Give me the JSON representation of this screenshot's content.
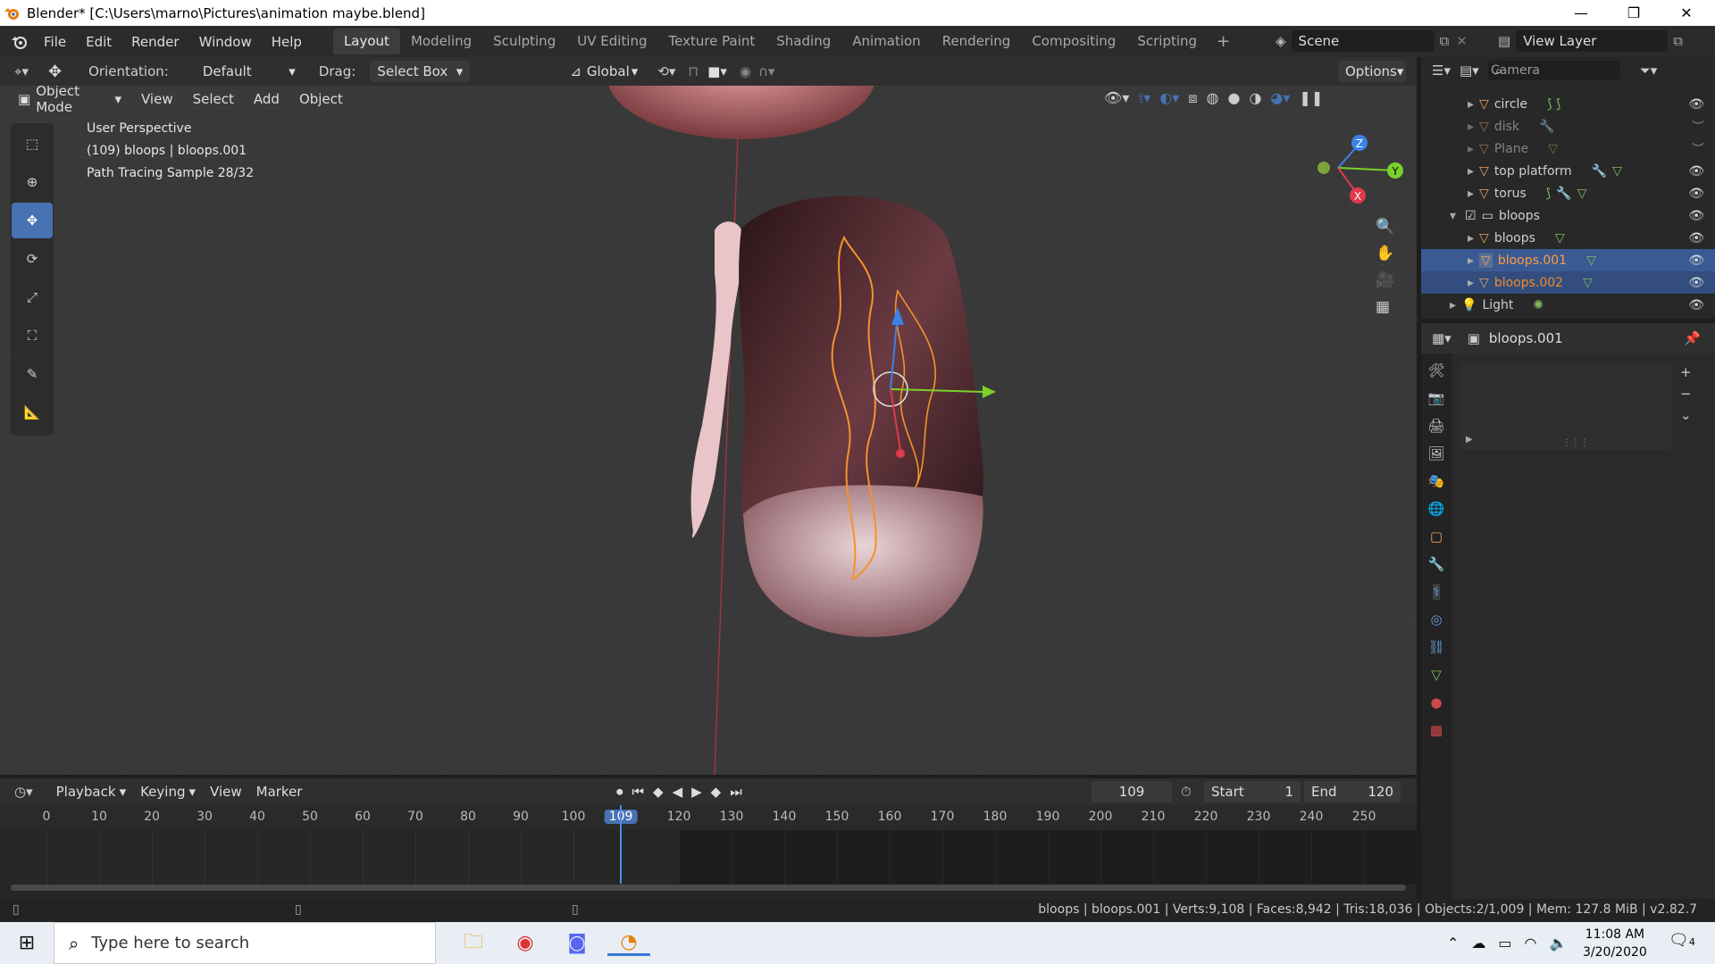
{
  "window": {
    "title": "Blender* [C:\\Users\\marno\\Pictures\\animation maybe.blend]"
  },
  "menu": [
    "File",
    "Edit",
    "Render",
    "Window",
    "Help"
  ],
  "workspaces": [
    "Layout",
    "Modeling",
    "Sculpting",
    "UV Editing",
    "Texture Paint",
    "Shading",
    "Animation",
    "Rendering",
    "Compositing",
    "Scripting"
  ],
  "scene": {
    "label": "Scene",
    "view_layer": "View Layer"
  },
  "header": {
    "orientation_label": "Orientation:",
    "orientation_value": "Default",
    "drag_label": "Drag:",
    "drag_value": "Select Box",
    "transform": "Global",
    "options": "Options"
  },
  "vp_header": {
    "mode": "Object Mode",
    "menus": [
      "View",
      "Select",
      "Add",
      "Object"
    ]
  },
  "viewport": {
    "info": [
      "User Perspective",
      "(109) bloops | bloops.001",
      "Path Tracing Sample 28/32"
    ],
    "axes": {
      "x": "X",
      "y": "Y",
      "z": "Z"
    }
  },
  "outliner": {
    "search_placeholder": "",
    "items": [
      {
        "name": "Camera",
        "dim": false
      },
      {
        "name": "circle",
        "dim": false
      },
      {
        "name": "disk",
        "dim": true
      },
      {
        "name": "Plane",
        "dim": true
      },
      {
        "name": "top platform",
        "dim": false
      },
      {
        "name": "torus",
        "dim": false
      },
      {
        "name": "bloops",
        "dim": false
      },
      {
        "name": "bloops",
        "dim": false
      },
      {
        "name": "bloops.001",
        "dim": false
      },
      {
        "name": "bloops.002",
        "dim": false
      },
      {
        "name": "Light",
        "dim": false
      }
    ]
  },
  "properties": {
    "object_name": "bloops.001"
  },
  "timeline": {
    "menus": [
      "Playback",
      "Keying",
      "View",
      "Marker"
    ],
    "current_frame": "109",
    "start_label": "Start",
    "start": "1",
    "end_label": "End",
    "end": "120",
    "ticks": [
      "0",
      "10",
      "20",
      "30",
      "40",
      "50",
      "60",
      "70",
      "80",
      "90",
      "100",
      "109",
      "120",
      "130",
      "140",
      "150",
      "160",
      "170",
      "180",
      "190",
      "200",
      "210",
      "220",
      "230",
      "240",
      "250"
    ]
  },
  "status": {
    "text": "bloops | bloops.001 | Verts:9,108 | Faces:8,942 | Tris:18,036 | Objects:2/1,009 | Mem: 127.8 MiB | v2.82.7"
  },
  "taskbar": {
    "search_placeholder": "Type here to search",
    "time": "11:08 AM",
    "date": "3/20/2020",
    "notif_count": "4"
  },
  "colors": {
    "accent": "#4772b3",
    "selected_text": "#ff9d3b",
    "viewport_bg": "#393939"
  }
}
